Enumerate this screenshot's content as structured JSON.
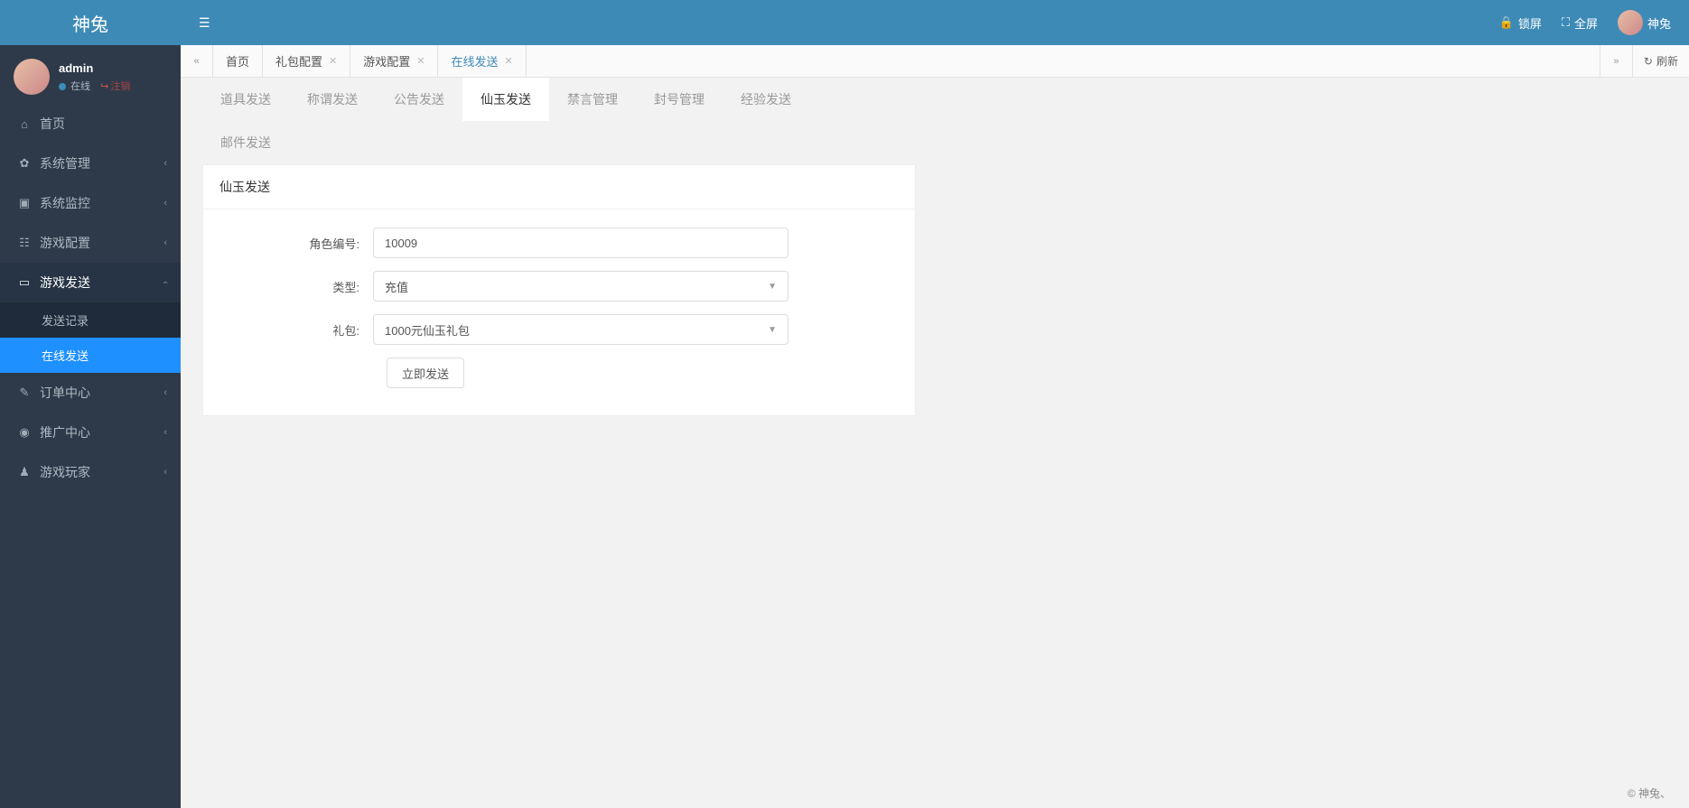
{
  "brand": "神兔",
  "header": {
    "lock": "锁屏",
    "fullscreen": "全屏",
    "username": "神兔"
  },
  "user": {
    "name": "admin",
    "online": "在线",
    "logout": "注销"
  },
  "sidebar": {
    "home": "首页",
    "sys_manage": "系统管理",
    "sys_monitor": "系统监控",
    "game_config": "游戏配置",
    "game_send": "游戏发送",
    "send_record": "发送记录",
    "online_send": "在线发送",
    "order_center": "订单中心",
    "promo_center": "推广中心",
    "game_player": "游戏玩家"
  },
  "tabs": {
    "home": "首页",
    "gift_config": "礼包配置",
    "game_config": "游戏配置",
    "online_send": "在线发送",
    "refresh": "刷新"
  },
  "inner_tabs": {
    "item_send": "道具发送",
    "title_send": "称谓发送",
    "notice_send": "公告发送",
    "xianyu_send": "仙玉发送",
    "mute_manage": "禁言管理",
    "ban_manage": "封号管理",
    "exp_send": "经验发送",
    "mail_send": "邮件发送"
  },
  "form": {
    "panel_title": "仙玉发送",
    "role_id_label": "角色编号:",
    "role_id_value": "10009",
    "type_label": "类型:",
    "type_value": "充值",
    "gift_label": "礼包:",
    "gift_value": "1000元仙玉礼包",
    "submit": "立即发送"
  },
  "footer": "© 神兔、"
}
